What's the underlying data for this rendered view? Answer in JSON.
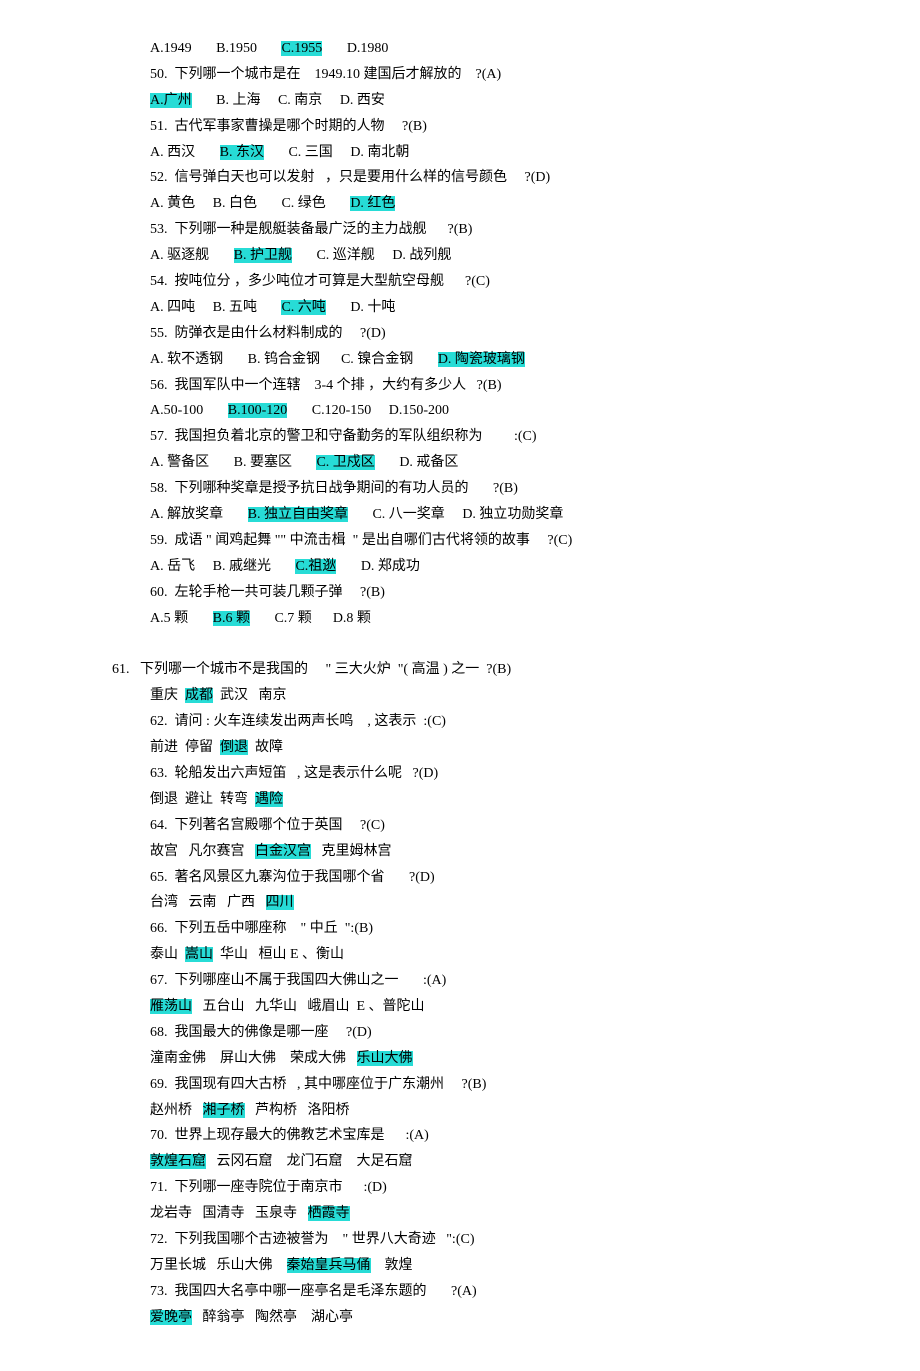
{
  "q49": {
    "a": "A.1949",
    "b": "B.1950",
    "c": "C.1955",
    "d": "D.1980"
  },
  "q50": {
    "stem": "50.  下列哪一个城市是在    1949.10 建国后才解放的    ?(A)",
    "a": "A.广州",
    "b": "B. 上海",
    "c": "C. 南京",
    "d": "D. 西安"
  },
  "q51": {
    "stem": "51.  古代军事家曹操是哪个时期的人物     ?(B)",
    "a": "A. 西汉",
    "b": "B. 东汉",
    "c": "C. 三国",
    "d": "D. 南北朝"
  },
  "q52": {
    "stem": "52.  信号弹白天也可以发射   ，只是要用什么样的信号颜色     ?(D)",
    "a": "A. 黄色",
    "b": "B. 白色",
    "c": "C. 绿色",
    "d": "D. 红色"
  },
  "q53": {
    "stem": "53.  下列哪一种是舰艇装备最广泛的主力战舰      ?(B)",
    "a": "A. 驱逐舰",
    "b": "B. 护卫舰",
    "c": "C. 巡洋舰",
    "d": "D. 战列舰"
  },
  "q54": {
    "stem": "54.  按吨位分 ，多少吨位才可算是大型航空母舰      ?(C)",
    "a": "A. 四吨",
    "b": "B. 五吨",
    "c": "C. 六吨",
    "d": "D. 十吨"
  },
  "q55": {
    "stem": "55.  防弹衣是由什么材料制成的     ?(D)",
    "a": "A. 软不透钢",
    "b": "B. 钨合金钢",
    "c": "C. 镍合金钢",
    "d": "D. 陶瓷玻璃钢"
  },
  "q56": {
    "stem": "56.  我国军队中一个连辖    3-4 个排 ，大约有多少人   ?(B)",
    "a": "A.50-100",
    "b": "B.100-120",
    "c": "C.120-150",
    "d": "D.150-200"
  },
  "q57": {
    "stem": "57.  我国担负着北京的警卫和守备勤务的军队组织称为         :(C)",
    "a": "A. 警备区",
    "b": "B. 要塞区",
    "c": "C. 卫戍区",
    "d": "D. 戒备区"
  },
  "q58": {
    "stem": "58.  下列哪种奖章是授予抗日战争期间的有功人员的       ?(B)",
    "a": "A. 解放奖章",
    "b": "B. 独立自由奖章",
    "c": "C. 八一奖章",
    "d": "D. 独立功勋奖章"
  },
  "q59": {
    "stem": "59.  成语 \" 闻鸡起舞 \"\" 中流击楫  \" 是出自哪们古代将领的故事     ?(C)",
    "a": "A. 岳飞",
    "b": "B. 戚继光",
    "c": "C.祖逖",
    "d": "D. 郑成功"
  },
  "q60": {
    "stem": "60.  左轮手枪一共可装几颗子弹     ?(B)",
    "a": "A.5 颗",
    "b": "B.6 颗",
    "c": "C.7 颗",
    "d": "D.8 颗"
  },
  "q61": {
    "stem": "61.   下列哪一个城市不是我国的     \" 三大火炉  \"( 高温 ) 之一  ?(B)",
    "a1": "重庆  ",
    "ans": "成都",
    "a2": "  武汉   南京"
  },
  "q62": {
    "stem": "62.  请问 : 火车连续发出两声长鸣    , 这表示  :(C)",
    "a1": "前进  停留  ",
    "ans": "倒退",
    "a2": "  故障"
  },
  "q63": {
    "stem": "63.  轮船发出六声短笛   , 这是表示什么呢   ?(D)",
    "a1": "倒退  避让  转弯  ",
    "ans": "遇险"
  },
  "q64": {
    "stem": "64.  下列著名宫殿哪个位于英国     ?(C)",
    "a1": "故宫   凡尔赛宫   ",
    "ans": "白金汉宫",
    "a2": "   克里姆林宫"
  },
  "q65": {
    "stem": "65.  著名风景区九寨沟位于我国哪个省       ?(D)",
    "a1": "台湾   云南   广西   ",
    "ans": "四川"
  },
  "q66": {
    "stem": "66.  下列五岳中哪座称    \" 中丘  \":(B)",
    "a1": "泰山  ",
    "ans": "嵩山",
    "a2": "  华山   桓山 E 、衡山"
  },
  "q67": {
    "stem": "67.  下列哪座山不属于我国四大佛山之一       :(A)",
    "ans": "雁荡山",
    "a2": "   五台山   九华山   峨眉山  E 、普陀山"
  },
  "q68": {
    "stem": "68.  我国最大的佛像是哪一座     ?(D)",
    "a1": "潼南金佛    屏山大佛    荣成大佛   ",
    "ans": "乐山大佛"
  },
  "q69": {
    "stem": "69.  我国现有四大古桥   , 其中哪座位于广东潮州     ?(B)",
    "a1": "赵州桥   ",
    "ans": "湘子桥",
    "a2": "   芦构桥   洛阳桥"
  },
  "q70": {
    "stem": "70.  世界上现存最大的佛教艺术宝库是      :(A)",
    "ans": "敦煌石窟",
    "a2": "   云冈石窟    龙门石窟    大足石窟"
  },
  "q71": {
    "stem": "71.  下列哪一座寺院位于南京市      :(D)",
    "a1": "龙岩寺   国清寺   玉泉寺   ",
    "ans": "栖霞寺"
  },
  "q72": {
    "stem": "72.  下列我国哪个古迹被誉为    \" 世界八大奇迹   \":(C)",
    "a1": "万里长城   乐山大佛    ",
    "ans": "秦始皇兵马俑",
    "a2": "    敦煌"
  },
  "q73": {
    "stem": "73.  我国四大名亭中哪一座亭名是毛泽东题的       ?(A)",
    "ans": "爱晚亭",
    "a2": "   醉翁亭   陶然亭    湖心亭"
  }
}
